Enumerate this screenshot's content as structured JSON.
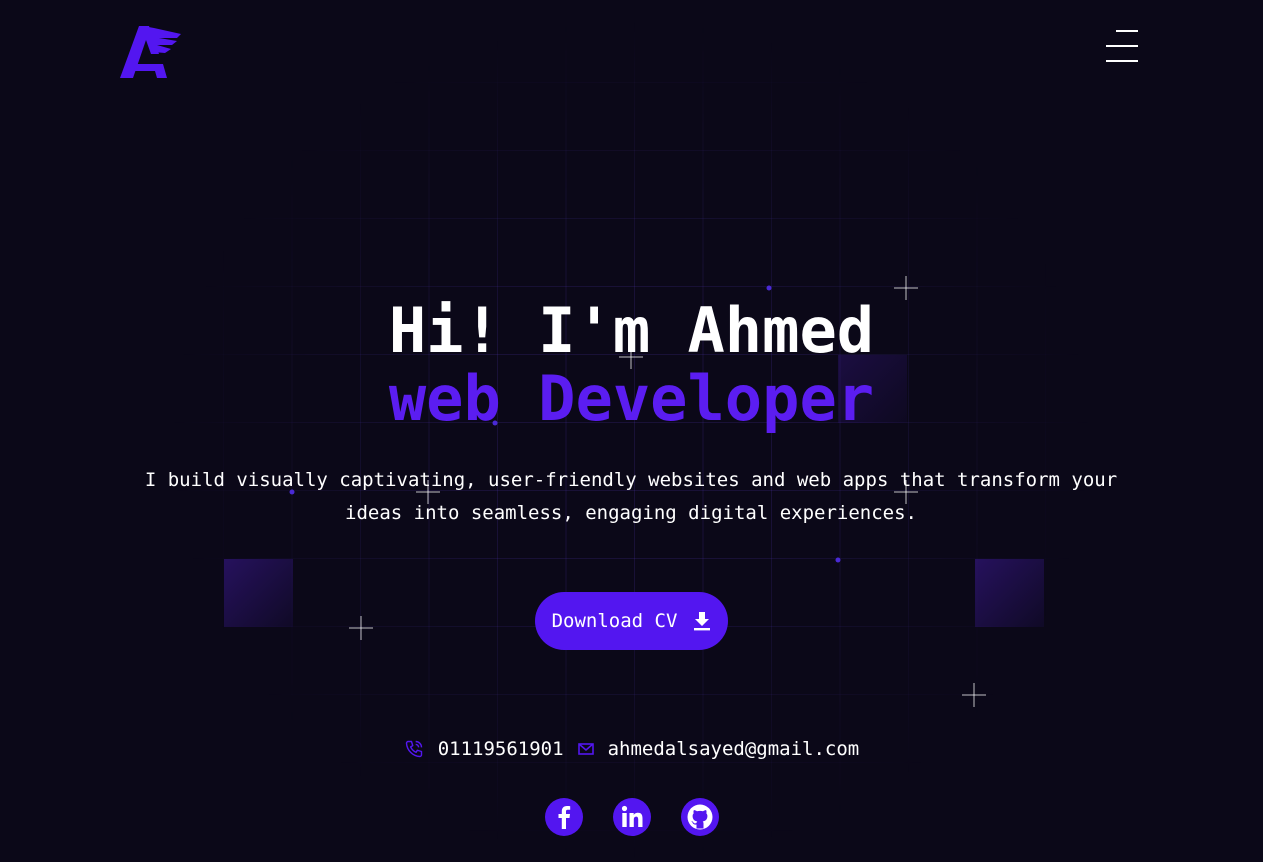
{
  "header": {
    "logo": {
      "icon": "winged-a-logo",
      "color": "#5316f0"
    },
    "menu_button": {
      "icon": "hamburger-menu-icon"
    }
  },
  "hero": {
    "greeting": "Hi! I'm Ahmed",
    "role": "web Developer",
    "description": "I build visually captivating, user-friendly websites and web apps that transform your ideas into seamless, engaging digital experiences.",
    "cta": {
      "label": "Download CV",
      "icon": "download-icon"
    }
  },
  "contact": {
    "phone": {
      "icon": "phone-icon",
      "value": "01119561901"
    },
    "email": {
      "icon": "mail-icon",
      "value": "ahmedalsayed@gmail.com"
    }
  },
  "socials": [
    {
      "name": "Facebook",
      "icon": "facebook-icon"
    },
    {
      "name": "LinkedIn",
      "icon": "linkedin-icon"
    },
    {
      "name": "GitHub",
      "icon": "github-icon"
    }
  ],
  "theme": {
    "background": "#0b0818",
    "accent": "#5316f0",
    "text": "#ffffff"
  }
}
